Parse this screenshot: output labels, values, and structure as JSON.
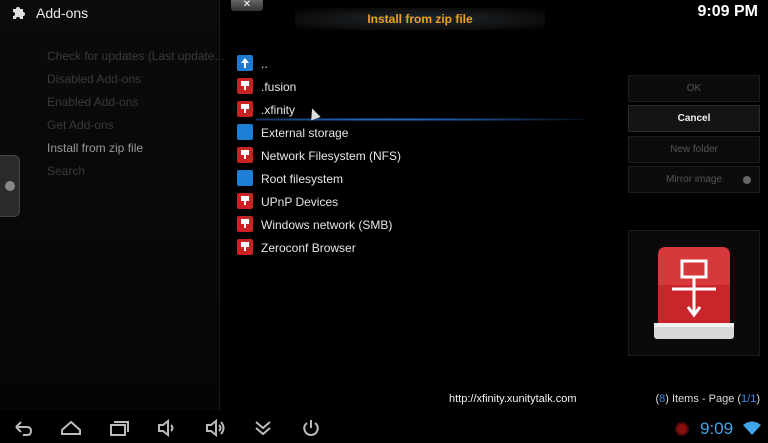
{
  "app": {
    "title": "Add-ons"
  },
  "background_menu": [
    {
      "label": "Check for updates (Last update...",
      "active": false
    },
    {
      "label": "Disabled Add-ons",
      "active": false
    },
    {
      "label": "Enabled Add-ons",
      "active": false
    },
    {
      "label": "Get Add-ons",
      "active": false
    },
    {
      "label": "Install from zip file",
      "active": true
    },
    {
      "label": "Search",
      "active": false
    }
  ],
  "dialog": {
    "close_label": "✕",
    "title": "Install from zip file"
  },
  "clock_top": "9:09 PM",
  "file_list": [
    {
      "label": "..",
      "icon": "up-arrow-icon"
    },
    {
      "label": ".fusion",
      "icon": "red-drive-icon"
    },
    {
      "label": ".xfinity",
      "icon": "red-drive-icon",
      "selected": true
    },
    {
      "label": "External storage",
      "icon": "blue-drive-icon"
    },
    {
      "label": "Network Filesystem (NFS)",
      "icon": "red-drive-icon"
    },
    {
      "label": "Root filesystem",
      "icon": "blue-drive-icon"
    },
    {
      "label": "UPnP Devices",
      "icon": "red-drive-icon"
    },
    {
      "label": "Windows network (SMB)",
      "icon": "red-drive-icon"
    },
    {
      "label": "Zeroconf Browser",
      "icon": "red-drive-icon"
    }
  ],
  "buttons": {
    "ok": "OK",
    "cancel": "Cancel",
    "new_folder": "New folder",
    "mirror_image": "Mirror image"
  },
  "preview_icon": "network-drive-icon",
  "url": "http://xfinity.xunitytalk.com",
  "items": {
    "count_open": "(",
    "count": "8",
    "count_close": ") Items - Page (",
    "page": "1/1",
    "page_close": ")"
  },
  "status_bar": {
    "clock": "9:09"
  },
  "colors": {
    "accent_orange": "#f0a020",
    "accent_blue": "#3a8cf0",
    "drive_red": "#d42a2a",
    "clock_blue": "#41a5e8"
  }
}
